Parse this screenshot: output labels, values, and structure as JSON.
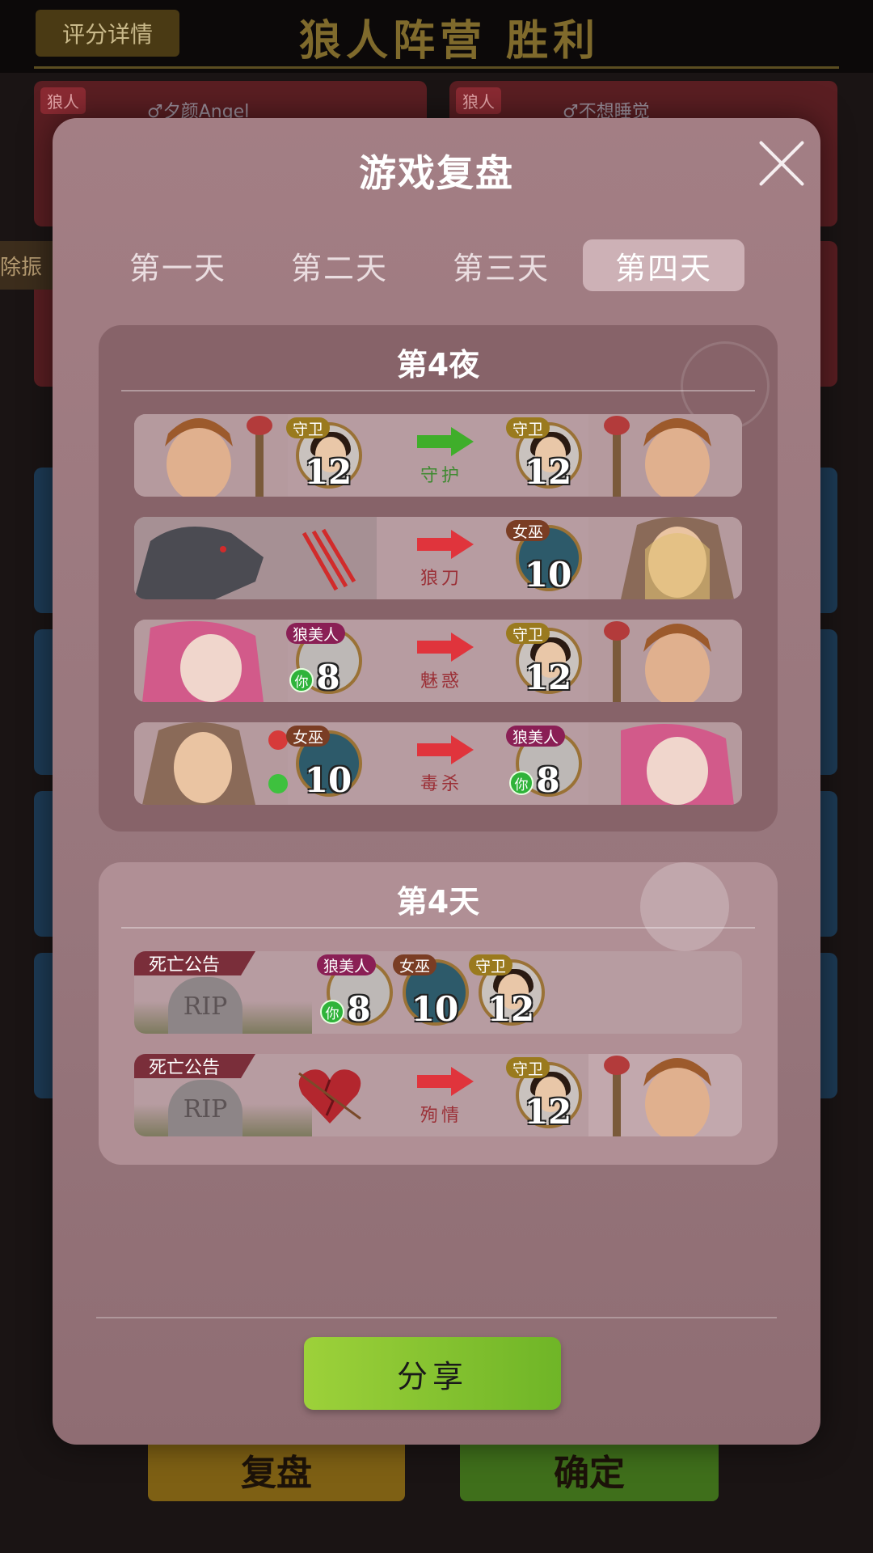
{
  "background": {
    "score_button": "评分详情",
    "result_title": "狼人阵营  胜利",
    "cards": [
      {
        "tag": "狼人",
        "name": "♂夕颜Angel"
      },
      {
        "tag": "狼人",
        "name": "♂不想睡觉"
      }
    ],
    "side_label": "除振",
    "review_button": "复盘",
    "confirm_button": "确定"
  },
  "modal": {
    "title": "游戏复盘",
    "tabs": [
      {
        "label": "第一天",
        "active": false
      },
      {
        "label": "第二天",
        "active": false
      },
      {
        "label": "第三天",
        "active": false
      },
      {
        "label": "第四天",
        "active": true
      }
    ],
    "share_button": "分享"
  },
  "night": {
    "title": "第4夜",
    "events": [
      {
        "actor": {
          "role": "守卫",
          "number": "12"
        },
        "action": "守护",
        "arrow": "green",
        "target": {
          "role": "守卫",
          "number": "12"
        }
      },
      {
        "actor": {
          "role": "",
          "number": ""
        },
        "action": "狼刀",
        "arrow": "red",
        "target": {
          "role": "女巫",
          "number": "10"
        }
      },
      {
        "actor": {
          "role": "狼美人",
          "number": "8",
          "you": "你"
        },
        "action": "魅惑",
        "arrow": "red",
        "target": {
          "role": "守卫",
          "number": "12"
        }
      },
      {
        "actor": {
          "role": "女巫",
          "number": "10"
        },
        "action": "毒杀",
        "arrow": "red",
        "target": {
          "role": "狼美人",
          "number": "8",
          "you": "你"
        }
      }
    ]
  },
  "day": {
    "title": "第4天",
    "events": [
      {
        "tag": "死亡公告",
        "tomb": "RIP",
        "deaths": [
          {
            "role": "狼美人",
            "number": "8",
            "you": "你"
          },
          {
            "role": "女巫",
            "number": "10"
          },
          {
            "role": "守卫",
            "number": "12"
          }
        ]
      },
      {
        "tag": "死亡公告",
        "tomb": "RIP",
        "action": "殉情",
        "target": {
          "role": "守卫",
          "number": "12"
        }
      }
    ]
  },
  "colors": {
    "modal_bg": "#a37e84",
    "tab_active": "#cdb1b6",
    "share_green": "#8cc63a",
    "arrow_green": "#3fae2a",
    "arrow_red": "#e0343c"
  }
}
